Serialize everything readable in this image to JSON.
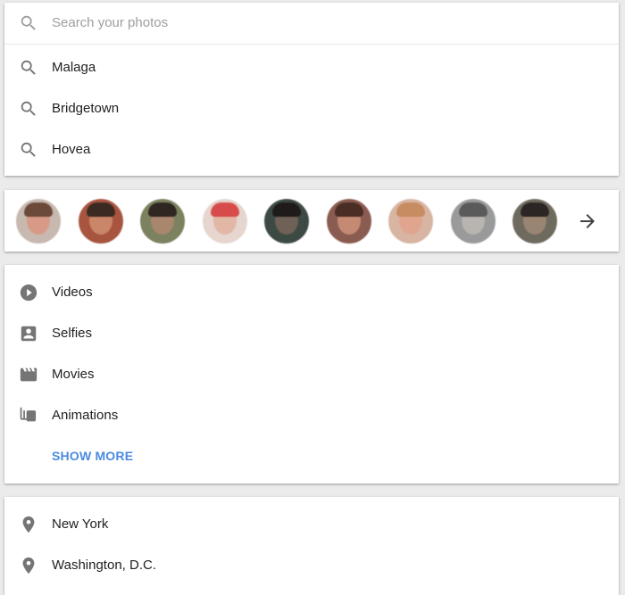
{
  "search": {
    "placeholder": "Search your photos",
    "suggestions": [
      {
        "label": "Malaga",
        "icon": "search-icon"
      },
      {
        "label": "Bridgetown",
        "icon": "search-icon"
      },
      {
        "label": "Hovea",
        "icon": "search-icon"
      }
    ]
  },
  "people": {
    "avatars": [
      {
        "skin": "#d89a86",
        "hair": "#6b4a3a",
        "bg": "#c7b9b0"
      },
      {
        "skin": "#c98668",
        "hair": "#3b2a22",
        "bg": "#a8553f"
      },
      {
        "skin": "#a9866e",
        "hair": "#2e2620",
        "bg": "#7c8260"
      },
      {
        "skin": "#e2b7a6",
        "hair": "#d84b4b",
        "bg": "#e6d6cf"
      },
      {
        "skin": "#6f6156",
        "hair": "#1f1b1a",
        "bg": "#3d4a44"
      },
      {
        "skin": "#c58a74",
        "hair": "#4a2d25",
        "bg": "#8a5b50"
      },
      {
        "skin": "#e0a58f",
        "hair": "#c88c62",
        "bg": "#d8b5a2"
      },
      {
        "skin": "#b8b4b0",
        "hair": "#5a5a5a",
        "bg": "#9a9a9a"
      },
      {
        "skin": "#9a8572",
        "hair": "#2b2624",
        "bg": "#6f6a5e"
      }
    ],
    "next_icon": "arrow-right-icon"
  },
  "categories": {
    "items": [
      {
        "label": "Videos",
        "icon": "play-circle-icon"
      },
      {
        "label": "Selfies",
        "icon": "portrait-icon"
      },
      {
        "label": "Movies",
        "icon": "movie-icon"
      },
      {
        "label": "Animations",
        "icon": "animation-icon"
      }
    ],
    "show_more_label": "SHOW MORE"
  },
  "places": {
    "items": [
      {
        "label": "New York",
        "icon": "place-icon"
      },
      {
        "label": "Washington, D.C.",
        "icon": "place-icon"
      }
    ]
  },
  "colors": {
    "accent": "#4a8ae0",
    "icon": "#757575",
    "text": "#212121",
    "placeholder": "#9e9e9e",
    "background": "#ebebeb"
  }
}
